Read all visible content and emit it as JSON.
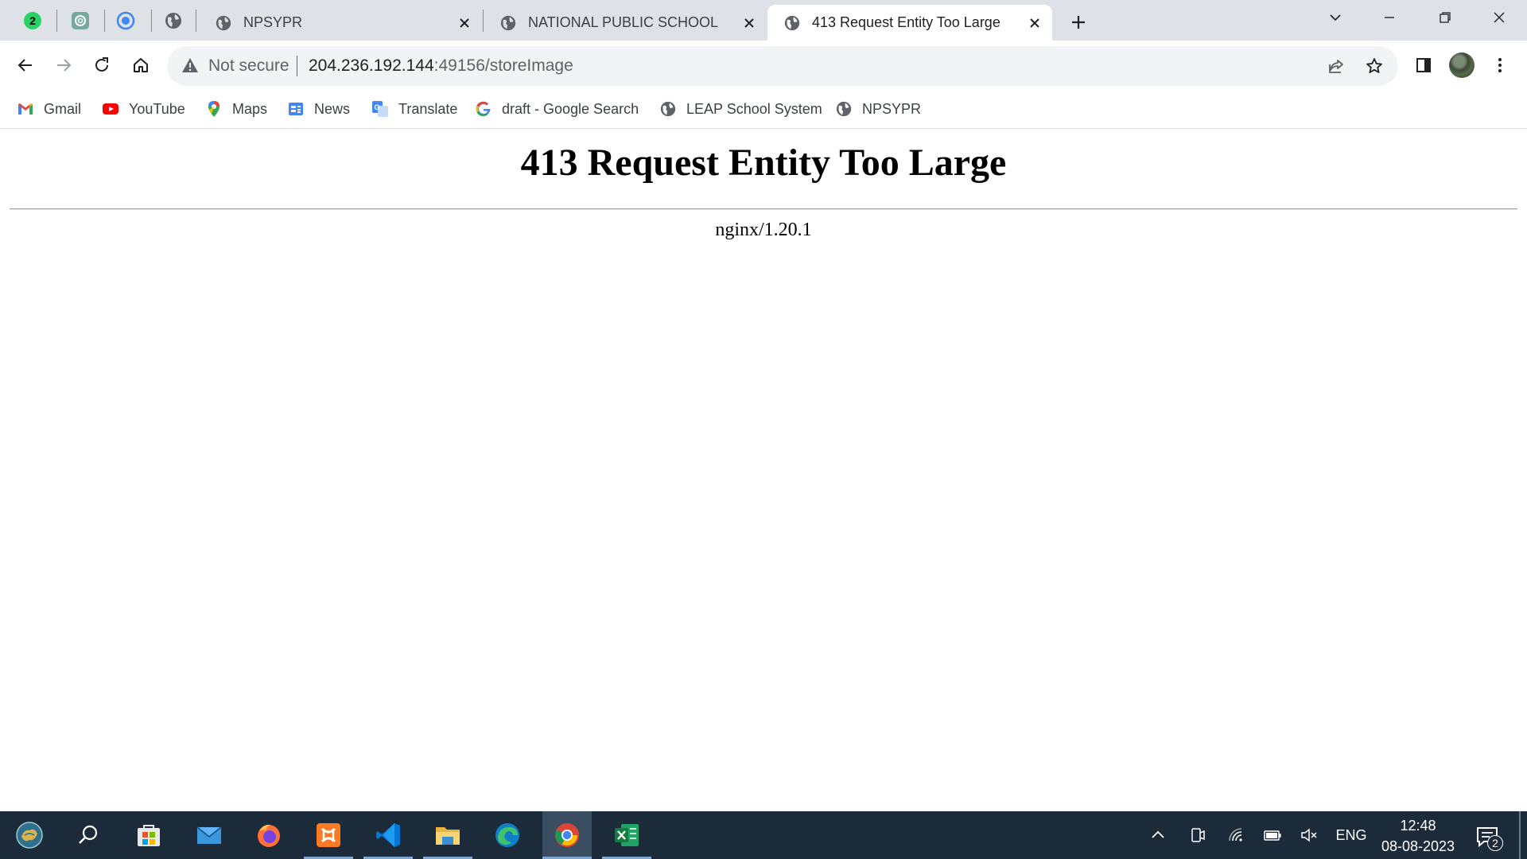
{
  "browser": {
    "pinned_tabs": [
      {
        "icon": "whatsapp-icon",
        "badge": "2"
      },
      {
        "icon": "chatgpt-icon"
      },
      {
        "icon": "chrome-remote-icon"
      },
      {
        "icon": "globe-icon"
      }
    ],
    "tabs": [
      {
        "title": "NPSYPR",
        "icon": "globe-icon",
        "active": false
      },
      {
        "title": "NATIONAL PUBLIC SCHOOL",
        "icon": "globe-icon",
        "active": false
      },
      {
        "title": "413 Request Entity Too Large",
        "icon": "globe-icon",
        "active": true
      }
    ],
    "omnibox": {
      "security_label": "Not secure",
      "host": "204.236.192.144",
      "path": ":49156/storeImage"
    },
    "bookmarks": [
      {
        "label": "Gmail",
        "icon": "gmail-icon"
      },
      {
        "label": "YouTube",
        "icon": "youtube-icon"
      },
      {
        "label": "Maps",
        "icon": "maps-icon"
      },
      {
        "label": "News",
        "icon": "news-icon"
      },
      {
        "label": "Translate",
        "icon": "translate-icon"
      },
      {
        "label": "draft - Google Search",
        "icon": "google-icon"
      },
      {
        "label": "LEAP School System",
        "icon": "globe-icon"
      },
      {
        "label": "NPSYPR",
        "icon": "globe-icon"
      }
    ]
  },
  "page": {
    "heading": "413 Request Entity Too Large",
    "server": "nginx/1.20.1"
  },
  "taskbar": {
    "apps": [
      "start-icon",
      "search-icon",
      "store-icon",
      "mail-icon",
      "firefox-icon",
      "xampp-icon",
      "vscode-icon",
      "file-explorer-icon",
      "edge-icon",
      "chrome-icon",
      "excel-icon"
    ],
    "language": "ENG",
    "time": "12:48",
    "date": "08-08-2023",
    "notification_count": "2"
  },
  "colors": {
    "tabstrip_bg": "#dee1e6",
    "taskbar_bg": "#1c2b3a",
    "omnibox_bg": "#f1f3f4"
  }
}
